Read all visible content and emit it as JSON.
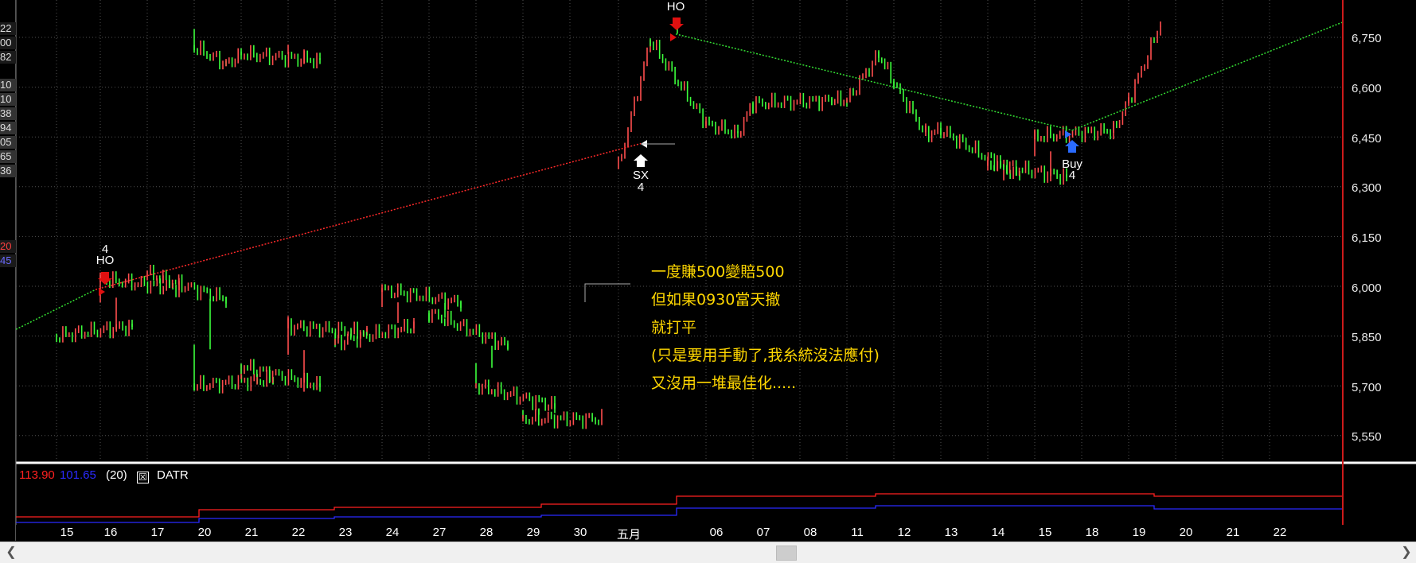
{
  "left_panel": [
    {
      "text": "22",
      "style": "dark"
    },
    {
      "text": "00",
      "style": "dark"
    },
    {
      "text": "82",
      "style": "dark"
    },
    {
      "text": "10",
      "style": "normal"
    },
    {
      "text": "10",
      "style": "normal"
    },
    {
      "text": "38",
      "style": "normal"
    },
    {
      "text": "94",
      "style": "normal"
    },
    {
      "text": "05",
      "style": "normal"
    },
    {
      "text": "65",
      "style": "normal"
    },
    {
      "text": "36",
      "style": "normal"
    },
    {
      "text": "20",
      "style": "red"
    },
    {
      "text": "45",
      "style": "blue"
    }
  ],
  "price_axis": {
    "labels": [
      "6,750",
      "6,600",
      "6,450",
      "6,300",
      "6,150",
      "6,000",
      "5,850",
      "5,700",
      "5,550"
    ]
  },
  "date_axis": {
    "labels": [
      "15",
      "16",
      "17",
      "20",
      "21",
      "22",
      "23",
      "24",
      "27",
      "28",
      "29",
      "30",
      "五月",
      "06",
      "07",
      "08",
      "11",
      "12",
      "13",
      "14",
      "15",
      "18",
      "19",
      "20",
      "21",
      "22"
    ]
  },
  "signals": {
    "ho1_count": "4",
    "ho1_label": "HO",
    "sx_label": "SX",
    "sx_count": "4",
    "ho2_label": "HO",
    "buy_label": "Buy",
    "buy_count": "4"
  },
  "annotation": {
    "line1": "一度賺500變賠500",
    "line2": "但如果0930當天撤",
    "line3": "就打平",
    "line4": "(只是要用手動了,我糸統沒法應付)",
    "line5": "又沒用一堆最佳化....."
  },
  "indicator": {
    "value1": "113.90",
    "value2": "101.65",
    "param": "(20)",
    "box_symbol": "☒",
    "name": "DATR"
  },
  "colors": {
    "up": "#ff4d4d",
    "down": "#3cff3c",
    "grid": "#505050",
    "red_line": "#ff2a2a",
    "green_line": "#33dd33",
    "annotation": "#ffd700"
  },
  "chart_data": {
    "type": "line",
    "title": "",
    "ylim": [
      5500,
      6800
    ],
    "y_ticks": [
      6750,
      6600,
      6450,
      6300,
      6150,
      6000,
      5850,
      5700,
      5550
    ],
    "series": [
      {
        "x": [
          "15",
          "16",
          "16",
          "17",
          "17",
          "20",
          "20",
          "21",
          "21",
          "22",
          "22",
          "23",
          "23",
          "24",
          "24",
          "27",
          "27",
          "28",
          "28",
          "29",
          "29",
          "30"
        ],
        "values": [
          5850,
          5880,
          6020,
          5995,
          6040,
          5960,
          5700,
          5720,
          5760,
          5700,
          5880,
          5860,
          5830,
          5880,
          5990,
          5950,
          5920,
          5820,
          5700,
          5640,
          5600,
          5600
        ]
      },
      {
        "x": [
          "五月",
          "五月",
          "06",
          "06",
          "07",
          "08",
          "11",
          "11",
          "12",
          "12",
          "13",
          "14",
          "14",
          "15",
          "15",
          "18",
          "19",
          "19",
          "20",
          "20",
          "21",
          "22",
          "22"
        ],
        "values": [
          6360,
          6740,
          6490,
          6460,
          6550,
          6560,
          6560,
          6700,
          6610,
          6460,
          6470,
          6330,
          6370,
          6330,
          6450,
          6470,
          6560,
          6790,
          6720,
          6670,
          6700,
          6680,
          6700
        ]
      },
      {
        "x": [
          "15",
          "16",
          "17"
        ],
        "values": [
          5880,
          5990,
          6025
        ]
      }
    ],
    "trades": [
      {
        "from": {
          "x": "16",
          "y": 5990
        },
        "to": {
          "x": "五月",
          "y": 6430
        }
      },
      {
        "from": {
          "x": "五月",
          "y": 6760
        },
        "to": {
          "x": "15",
          "y": 6470
        }
      },
      {
        "from": {
          "x": "15",
          "y": 6470
        },
        "to": {
          "x": "22",
          "y": 6795
        }
      }
    ]
  }
}
